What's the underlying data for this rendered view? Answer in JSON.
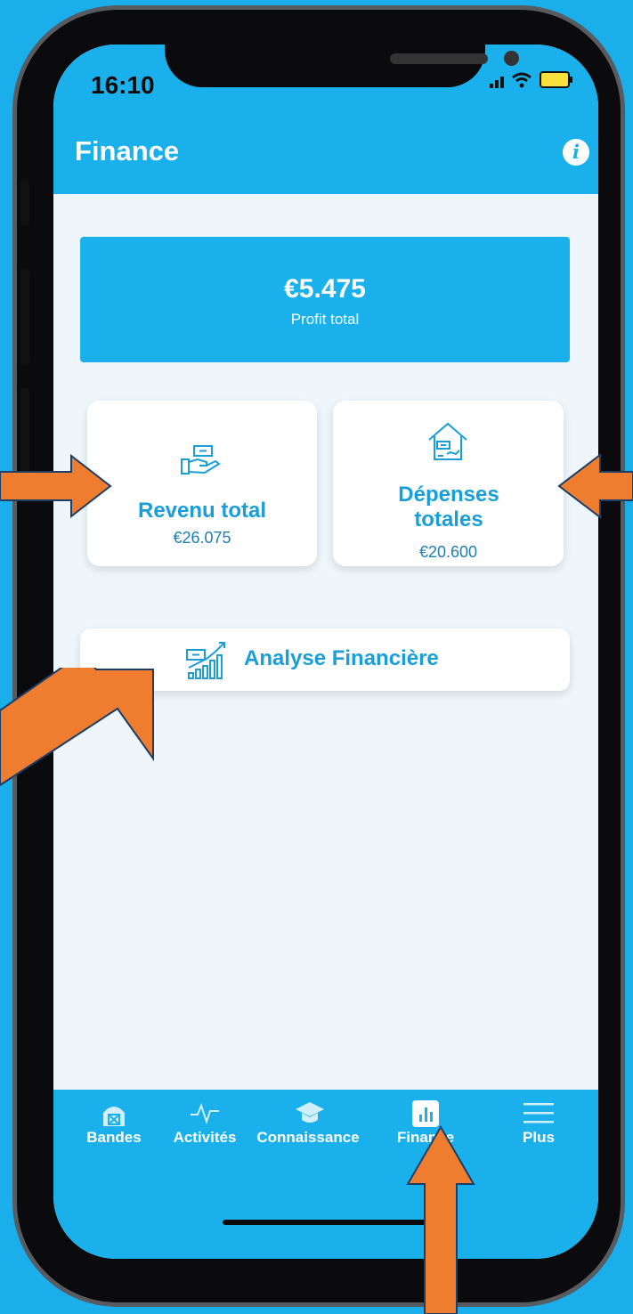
{
  "status_bar": {
    "time": "16:10"
  },
  "header": {
    "title": "Finance",
    "info_icon": "info-icon"
  },
  "profit": {
    "value": "€5.475",
    "label": "Profit total"
  },
  "revenue_card": {
    "title": "Revenu total",
    "value": "€26.075",
    "icon": "hand-money-icon"
  },
  "expense_card": {
    "title_line1": "Dépenses",
    "title_line2": "totales",
    "value": "€20.600",
    "icon": "house-expense-icon"
  },
  "analysis": {
    "label": "Analyse Financière",
    "icon": "growth-chart-icon"
  },
  "tabs": [
    {
      "label": "Bandes",
      "icon": "barn-icon"
    },
    {
      "label": "Activités",
      "icon": "activity-pulse-icon"
    },
    {
      "label": "Connaissance",
      "icon": "graduation-cap-icon"
    },
    {
      "label": "Finance",
      "icon": "bar-chart-icon"
    },
    {
      "label": "Plus",
      "icon": "menu-icon"
    }
  ],
  "colors": {
    "brand": "#1ab0eb",
    "arrow": "#ef7d30",
    "screen_bg": "#eef6fc"
  }
}
